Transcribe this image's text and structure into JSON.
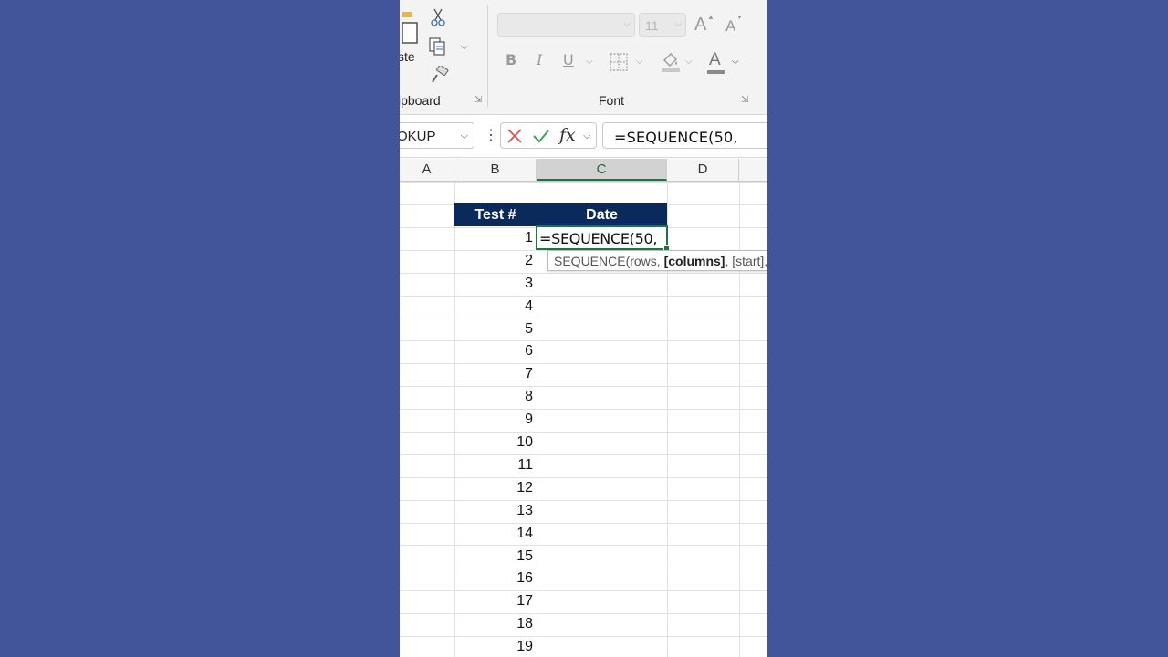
{
  "ribbon": {
    "paste_label": "ste",
    "clipboard_label": "ipboard",
    "font_group_label": "Font",
    "font_name_value": "",
    "font_size_value": "11",
    "bold": "B",
    "italic": "I",
    "underline": "U",
    "grow_font": "A",
    "shrink_font": "A",
    "font_color": "A"
  },
  "formula_bar": {
    "name_box": "OKUP",
    "fx": "fx",
    "formula": "=SEQUENCE(50,"
  },
  "columns": [
    "A",
    "B",
    "C",
    "D"
  ],
  "table": {
    "headers": [
      "Test #",
      "Date"
    ],
    "active_cell_text": "=SEQUENCE(50,",
    "row_numbers": [
      "1",
      "2",
      "3",
      "4",
      "5",
      "6",
      "7",
      "8",
      "9",
      "10",
      "11",
      "12",
      "13",
      "14",
      "15",
      "16",
      "17",
      "18",
      "19"
    ]
  },
  "tooltip": {
    "fn": "SEQUENCE(rows, ",
    "current_arg": "[columns]",
    "rest": ", [start], "
  },
  "colors": {
    "background": "#42559a",
    "header_fill": "#0b2a5c",
    "excel_green": "#217346",
    "cancel_red": "#d9534f"
  }
}
